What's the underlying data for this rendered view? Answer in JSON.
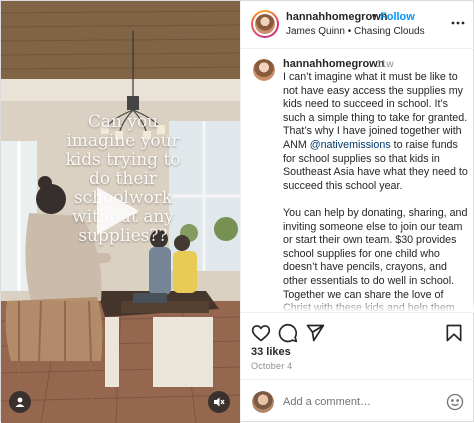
{
  "media": {
    "overlay_text": "Can you\nimagine your\nkids trying to\ndo their\nschoolwork\nwithout any\nsupplies??",
    "play_icon": "play-icon",
    "user_tag_icon": "user-tag-icon",
    "mute_icon": "speaker-muted-icon"
  },
  "header": {
    "username": "hannahhomegrown",
    "separator": "•",
    "follow_label": "Follow",
    "audio": "James Quinn • Chasing Clouds",
    "more_icon": "more-options-icon"
  },
  "caption": {
    "username": "hannahhomegrown",
    "time": "11w",
    "text_before_mention": "I can’t imagine what it must be like to not have easy access the supplies my kids need to succeed in school. It’s such a simple thing to take for granted. That’s why I have joined together with ANM ",
    "mention": "@nativemissions",
    "text_after_mention": " to raise funds for school supplies so that kids in Southeast Asia have what they need to succeed this school year.\n\nYou can help by donating, sharing, and inviting someone else to join our team or start their own team. $30 provides school supplies for one child who doesn’t have pencils, crayons, and other essentials to do well in school. Together we can share the love of Christ with these kids and help them get the school year off to a great start! Give Today!\nhttps://donate.nativemissions.org"
  },
  "actions": {
    "like_icon": "heart-icon",
    "comment_icon": "comment-icon",
    "share_icon": "share-icon",
    "save_icon": "bookmark-icon"
  },
  "likes": "33 likes",
  "date": "October 4",
  "comment": {
    "placeholder": "Add a comment…",
    "emoji_icon": "emoji-icon"
  },
  "colors": {
    "link_blue": "#0095f6",
    "mention_navy": "#00376b",
    "muted_gray": "#8e8e8e",
    "text": "#262626"
  }
}
